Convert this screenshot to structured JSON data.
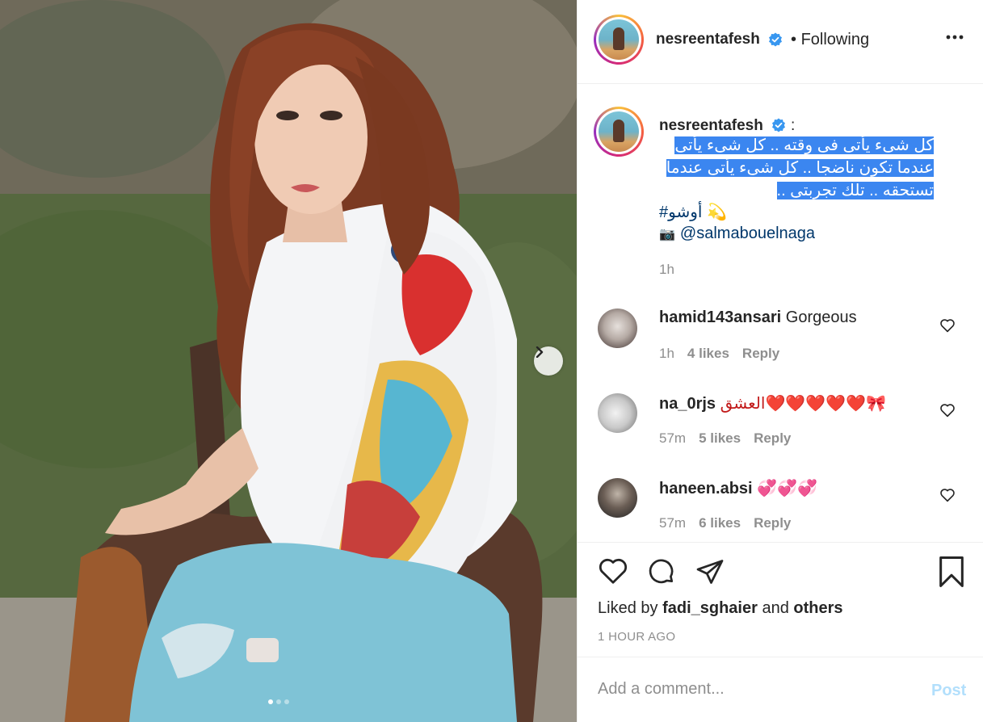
{
  "post_author": {
    "username": "nesreentafesh",
    "verified_icon": "verified-badge-icon",
    "separator": "•",
    "follow_status": "Following",
    "more_icon": "more-options-icon"
  },
  "caption": {
    "username": "nesreentafesh",
    "colon": ":",
    "text": "كل شىء يأتى فى وقته .. كل شىء يأتى عندما تكون ناضجا .. كل شىء يأتى عندما تستحقه .. تلك تجربتى ..",
    "hashtag": "#أوشو",
    "hashtag_emoji": "💫",
    "credit_icon": "📷",
    "credit_handle": "@salmabouelnaga",
    "time": "1h",
    "highlight_color": "#3b86f0"
  },
  "comments": [
    {
      "username": "hamid143ansari",
      "text": "Gorgeous",
      "time": "1h",
      "likes": "4 likes",
      "reply": "Reply"
    },
    {
      "username": "na_0rjs",
      "text": "العشق❤️❤️❤️❤️❤️🎀",
      "time": "57m",
      "likes": "5 likes",
      "reply": "Reply"
    },
    {
      "username": "haneen.absi",
      "text": "💞💞💞",
      "time": "57m",
      "likes": "6 likes",
      "reply": "Reply"
    }
  ],
  "actions": {
    "like_icon": "heart-icon",
    "comment_icon": "comment-bubble-icon",
    "share_icon": "paper-plane-icon",
    "save_icon": "bookmark-icon",
    "liked_by_prefix": "Liked by",
    "liked_by_user": "fadi_sghaier",
    "liked_by_and": "and",
    "liked_by_others": "others",
    "post_date": "1 HOUR AGO"
  },
  "comment_box": {
    "placeholder": "Add a comment...",
    "post_label": "Post"
  },
  "colors": {
    "link": "#00376b",
    "muted": "#8e8e8e",
    "verified": "#3897f0",
    "post_disabled": "#b2dffc"
  }
}
